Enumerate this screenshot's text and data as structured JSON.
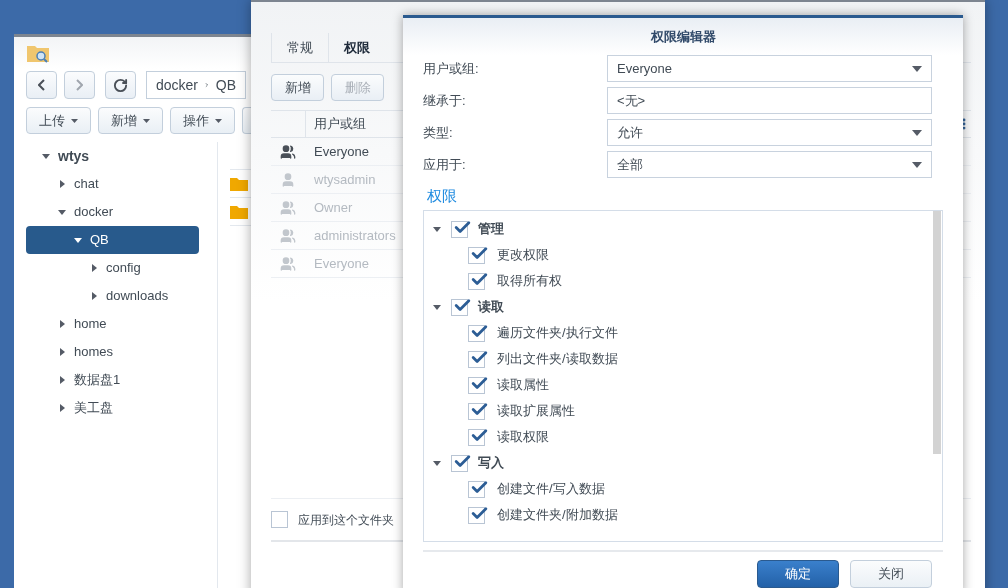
{
  "file_station": {
    "path": [
      "docker",
      "QB"
    ],
    "toolbar_buttons": [
      "上传",
      "新增",
      "操作"
    ],
    "tree": [
      {
        "label": "wtys",
        "expanded": true,
        "selected": false,
        "children": [
          {
            "label": "chat",
            "expanded": false,
            "selected": false
          },
          {
            "label": "docker",
            "expanded": true,
            "selected": false,
            "children": [
              {
                "label": "QB",
                "expanded": true,
                "selected": true,
                "children": [
                  {
                    "label": "config",
                    "expanded": false,
                    "selected": false
                  },
                  {
                    "label": "downloads",
                    "expanded": false,
                    "selected": false
                  }
                ]
              }
            ]
          },
          {
            "label": "home",
            "expanded": false,
            "selected": false
          },
          {
            "label": "homes",
            "expanded": false,
            "selected": false
          },
          {
            "label": "数据盘1",
            "expanded": false,
            "selected": false
          },
          {
            "label": "美工盘",
            "expanded": false,
            "selected": false
          }
        ]
      }
    ]
  },
  "properties": {
    "tabs": [
      {
        "label": "常规",
        "selected": false
      },
      {
        "label": "权限",
        "selected": true
      }
    ],
    "buttons": [
      {
        "label": "新增",
        "disabled": false
      },
      {
        "label": "删除",
        "disabled": true
      }
    ],
    "table": {
      "columns": [
        "用户或组"
      ],
      "rows": [
        {
          "name": "Everyone",
          "kind": "group",
          "disabled": false
        },
        {
          "name": "wtysadmin",
          "kind": "user",
          "disabled": true
        },
        {
          "name": "Owner",
          "kind": "group",
          "disabled": true
        },
        {
          "name": "administrators",
          "kind": "group",
          "disabled": true
        },
        {
          "name": "Everyone",
          "kind": "group",
          "disabled": true
        }
      ]
    },
    "apply_checkbox": {
      "label": "应用到这个文件夹",
      "checked": false
    }
  },
  "editor": {
    "title": "权限编辑器",
    "fields": [
      {
        "label": "用户或组:",
        "value": "Everyone",
        "kind": "select"
      },
      {
        "label": "继承于:",
        "value": "<无>",
        "kind": "text"
      },
      {
        "label": "类型:",
        "value": "允许",
        "kind": "select"
      },
      {
        "label": "应用于:",
        "value": "全部",
        "kind": "select"
      }
    ],
    "section_title": "权限",
    "permissions": [
      {
        "label": "管理",
        "checked": true,
        "expanded": true,
        "children": [
          {
            "label": "更改权限",
            "checked": true
          },
          {
            "label": "取得所有权",
            "checked": true
          }
        ]
      },
      {
        "label": "读取",
        "checked": true,
        "expanded": true,
        "children": [
          {
            "label": "遍历文件夹/执行文件",
            "checked": true
          },
          {
            "label": "列出文件夹/读取数据",
            "checked": true
          },
          {
            "label": "读取属性",
            "checked": true
          },
          {
            "label": "读取扩展属性",
            "checked": true
          },
          {
            "label": "读取权限",
            "checked": true
          }
        ]
      },
      {
        "label": "写入",
        "checked": true,
        "expanded": true,
        "children": [
          {
            "label": "创建文件/写入数据",
            "checked": true
          },
          {
            "label": "创建文件夹/附加数据",
            "checked": true
          }
        ]
      }
    ],
    "buttons": [
      {
        "label": "确定",
        "primary": true
      },
      {
        "label": "关闭",
        "primary": false
      }
    ]
  }
}
